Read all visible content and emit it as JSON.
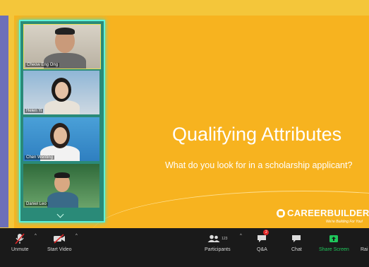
{
  "slide": {
    "title": "Qualifying Attributes",
    "subtitle": "What do you look for in a scholarship applicant?",
    "logo_text": "CAREERBUILDER",
    "tagline": "We're Building For You!"
  },
  "gallery": {
    "participants": [
      {
        "name": "Cheow Eng Ong"
      },
      {
        "name": "Helen Yi"
      },
      {
        "name": "Chen Wenting"
      },
      {
        "name": "Daniel Leo"
      }
    ]
  },
  "toolbar": {
    "unmute_label": "Unmute",
    "start_video_label": "Start Video",
    "participants_label": "Participants",
    "participants_count": "123",
    "qa_label": "Q&A",
    "qa_badge": "2",
    "chat_label": "Chat",
    "share_screen_label": "Share Screen",
    "raise_label": "Rai",
    "share_color": "#1fc75b",
    "badge_color": "#e02828"
  }
}
